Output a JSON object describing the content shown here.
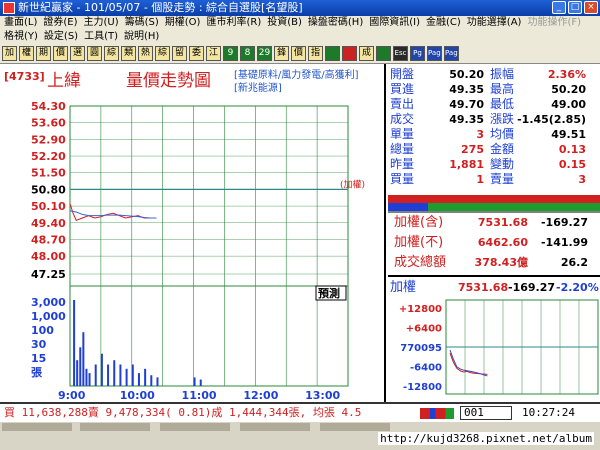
{
  "window": {
    "title": "新世紀贏家 - 101/05/07 - 個股走勢 : 綜合自選股[名望股]",
    "buttons": [
      "_",
      "□",
      "×"
    ]
  },
  "menu": {
    "row1": [
      "畫面(L)",
      "證券(E)",
      "主力(U)",
      "籌碼(S)",
      "期權(O)",
      "匯市利率(R)",
      "投資(B)",
      "操盤密碼(H)",
      "國際資訊(I)",
      "金融(C)",
      "功能選擇(A)",
      "功能操作(F)"
    ],
    "row2": [
      "格視(Y)",
      "設定(S)",
      "工具(T)",
      "說明(H)"
    ]
  },
  "toolbar": {
    "buttons": [
      "加",
      "權",
      "期",
      "價",
      "選",
      "圓",
      "綜",
      "類",
      "熱",
      "綜",
      "留",
      "委",
      "江",
      "9",
      "8",
      "29",
      "鋒",
      "價",
      "指",
      "",
      "",
      "成",
      "",
      "Esc",
      "Pg",
      "Page",
      "Page"
    ]
  },
  "stock": {
    "code": "[4733]",
    "name": "上緯",
    "chart_title": "量價走勢圖",
    "tags_line1": "[基礎原料/風力發電/高獲利]",
    "tags_line2": "[新兆能源]",
    "indicator_label": "(加權)",
    "price_ref_label": "50.80",
    "price_mid_label": "47.25",
    "bottom_tag": "預測"
  },
  "chart_data": [
    {
      "type": "line",
      "title": "量價走勢圖",
      "x_ticks": [
        "9:00",
        "10:00",
        "11:00",
        "12:00",
        "13:00"
      ],
      "y_ticks": [
        "54.30",
        "53.60",
        "52.90",
        "52.20",
        "51.50",
        "50.80",
        "50.10",
        "49.40",
        "48.70",
        "48.00",
        "47.25"
      ],
      "ylim": [
        47.25,
        54.3
      ],
      "reference_price": 50.8,
      "series": [
        {
          "color": "#d02020",
          "x": [
            0,
            0.05,
            0.1,
            0.2,
            0.3,
            0.4,
            0.5,
            0.6,
            0.7,
            0.8,
            0.9,
            1.0,
            1.1,
            1.2,
            1.3,
            1.4
          ],
          "y": [
            50.2,
            49.8,
            49.5,
            49.6,
            49.7,
            49.6,
            49.65,
            49.75,
            49.8,
            49.7,
            49.6,
            49.65,
            49.7,
            49.6,
            49.6,
            49.6
          ]
        },
        {
          "color": "#4060d0",
          "x": [
            0,
            0.1,
            0.2,
            0.3,
            0.4,
            0.5,
            0.6,
            0.7,
            0.8,
            0.9,
            1.0,
            1.1,
            1.2,
            1.3,
            1.4
          ],
          "y": [
            49.9,
            49.85,
            49.75,
            49.7,
            49.7,
            49.7,
            49.72,
            49.72,
            49.72,
            49.7,
            49.68,
            49.66,
            49.62,
            49.6,
            49.6
          ]
        }
      ]
    },
    {
      "type": "bar",
      "title": "volume",
      "y_ticks": [
        "3,000",
        "1,000",
        "100",
        "30",
        "15",
        "張"
      ],
      "x": [
        0.05,
        0.1,
        0.15,
        0.2,
        0.25,
        0.3,
        0.4,
        0.5,
        0.6,
        0.7,
        0.8,
        0.9,
        1.0,
        1.1,
        1.2,
        1.3,
        1.4,
        2.0,
        2.1
      ],
      "values": [
        40,
        12,
        18,
        25,
        8,
        6,
        10,
        15,
        10,
        12,
        10,
        8,
        10,
        6,
        8,
        5,
        4,
        4,
        3
      ]
    },
    {
      "type": "line",
      "title": "加權",
      "y_ticks": [
        "+12800",
        "+6400",
        "770095",
        "-6400",
        "-12800"
      ],
      "ylim": [
        -12800,
        12800
      ],
      "series": [
        {
          "color": "#d02020",
          "x": [
            0,
            0.1,
            0.2,
            0.3,
            0.4,
            0.5,
            0.6,
            0.7,
            0.8,
            0.9,
            1.0,
            1.1
          ],
          "y": [
            -2000,
            -5000,
            -7000,
            -7800,
            -8200,
            -8000,
            -8400,
            -8600,
            -8700,
            -8800,
            -8900,
            -9000
          ]
        },
        {
          "color": "#3050c8",
          "x": [
            0,
            0.1,
            0.2,
            0.3,
            0.4,
            0.5,
            0.6,
            0.7,
            0.8,
            0.9,
            1.0,
            1.1
          ],
          "y": [
            -1000,
            -4000,
            -6500,
            -7200,
            -7600,
            -7800,
            -8000,
            -8200,
            -8500,
            -8800,
            -9200,
            -9500
          ]
        }
      ]
    }
  ],
  "quote": {
    "rows": [
      {
        "l1": "開盤",
        "v1": "50.20",
        "l2": "振幅",
        "v2": "2.36%",
        "c1": "#000",
        "c2": "#d02020"
      },
      {
        "l1": "買進",
        "v1": "49.35",
        "l2": "最高",
        "v2": "50.20",
        "c1": "#000",
        "c2": "#000"
      },
      {
        "l1": "賣出",
        "v1": "49.70",
        "l2": "最低",
        "v2": "49.00",
        "c1": "#000",
        "c2": "#000"
      },
      {
        "l1": "成交",
        "v1": "49.35",
        "l2": "漲跌",
        "v2": "-1.45(2.85)",
        "c1": "#000",
        "c2": "#000"
      },
      {
        "l1": "單量",
        "v1": "3",
        "l2": "均價",
        "v2": "49.51",
        "c1": "#d02020",
        "c2": "#000"
      },
      {
        "l1": "總量",
        "v1": "275",
        "l2": "金額",
        "v2": "0.13",
        "c1": "#d02020",
        "c2": "#d02020"
      },
      {
        "l1": "昨量",
        "v1": "1,881",
        "l2": "變動",
        "v2": "0.15",
        "c1": "#d02020",
        "c2": "#d02020"
      },
      {
        "l1": "買量",
        "v1": "1",
        "l2": "賣量",
        "v2": "3",
        "c1": "#d02020",
        "c2": "#d02020"
      }
    ],
    "index_rows": [
      {
        "label": "加權(含)",
        "value": "7531.68",
        "change": "-169.27"
      },
      {
        "label": "加權(不)",
        "value": "6462.60",
        "change": "-141.99"
      },
      {
        "label": "成交總額",
        "value": "378.43億",
        "change": "26.2"
      }
    ],
    "mini_label": "加權",
    "mini_value": "7531.68",
    "mini_change": "-169.27",
    "mini_pct": "-2.20%"
  },
  "status": {
    "text": "買 11,638,288賣 9,478,334( 0.81)成 1,444,344張, 均張 4.5",
    "code_input": "001",
    "clock": "10:27:24"
  },
  "taskbar": {
    "url": "http://kujd3268.pixnet.net/album"
  },
  "colors": {
    "up": "#d02020",
    "down": "#1e9d2e",
    "axis_blue": "#1e3fd4",
    "grid_green": "#2a8a3a",
    "ref_line": "#2a8a8a"
  }
}
